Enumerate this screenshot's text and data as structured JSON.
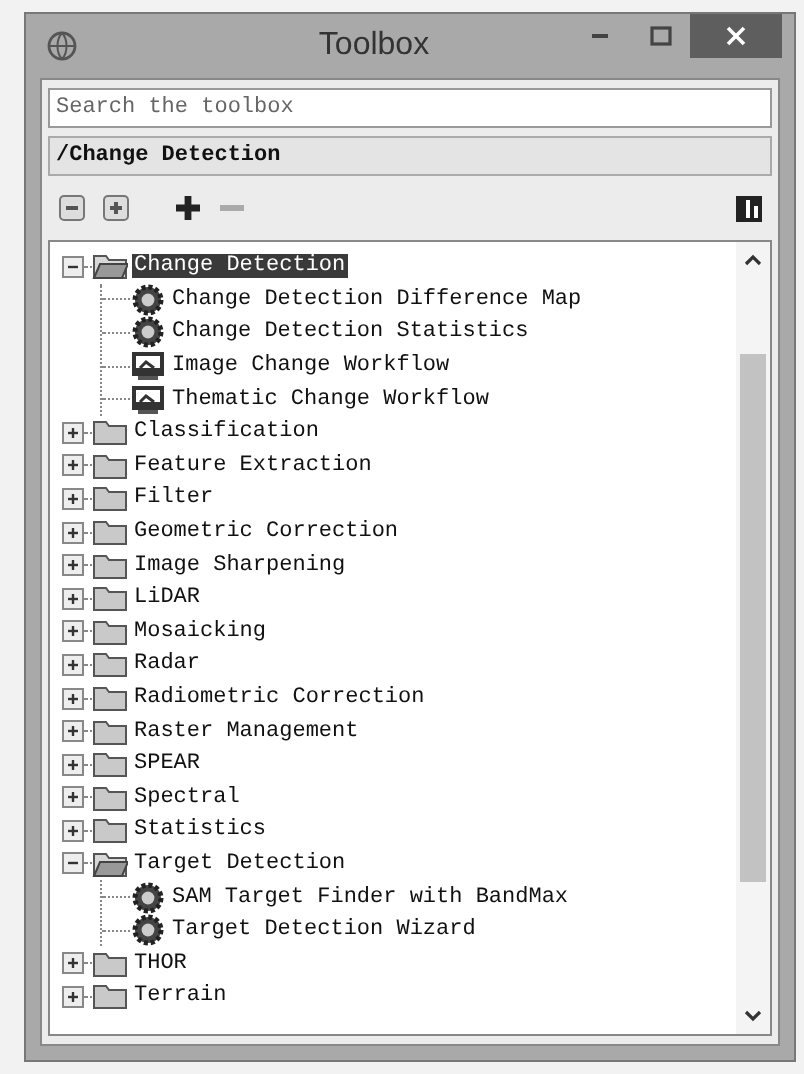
{
  "window": {
    "title": "Toolbox"
  },
  "search": {
    "placeholder": "Search the toolbox"
  },
  "path": "/Change Detection",
  "tree": [
    {
      "label": "Change Detection",
      "kind": "folder",
      "expanded": true,
      "selected": true,
      "children": [
        {
          "label": "Change Detection Difference Map",
          "kind": "tool",
          "selected": false
        },
        {
          "label": "Change Detection Statistics",
          "kind": "tool",
          "selected": false
        },
        {
          "label": "Image Change Workflow",
          "kind": "workflow",
          "selected": false
        },
        {
          "label": "Thematic Change Workflow",
          "kind": "workflow",
          "selected": false
        }
      ]
    },
    {
      "label": "Classification",
      "kind": "folder",
      "expanded": false,
      "selected": false
    },
    {
      "label": "Feature Extraction",
      "kind": "folder",
      "expanded": false,
      "selected": false
    },
    {
      "label": "Filter",
      "kind": "folder",
      "expanded": false,
      "selected": false
    },
    {
      "label": "Geometric Correction",
      "kind": "folder",
      "expanded": false,
      "selected": false
    },
    {
      "label": "Image Sharpening",
      "kind": "folder",
      "expanded": false,
      "selected": false
    },
    {
      "label": "LiDAR",
      "kind": "folder",
      "expanded": false,
      "selected": false
    },
    {
      "label": "Mosaicking",
      "kind": "folder",
      "expanded": false,
      "selected": false
    },
    {
      "label": "Radar",
      "kind": "folder",
      "expanded": false,
      "selected": false
    },
    {
      "label": "Radiometric Correction",
      "kind": "folder",
      "expanded": false,
      "selected": false
    },
    {
      "label": "Raster Management",
      "kind": "folder",
      "expanded": false,
      "selected": false
    },
    {
      "label": "SPEAR",
      "kind": "folder",
      "expanded": false,
      "selected": false
    },
    {
      "label": "Spectral",
      "kind": "folder",
      "expanded": false,
      "selected": false
    },
    {
      "label": "Statistics",
      "kind": "folder",
      "expanded": false,
      "selected": false
    },
    {
      "label": "Target Detection",
      "kind": "folder",
      "expanded": true,
      "selected": false,
      "children": [
        {
          "label": "SAM Target Finder with BandMax",
          "kind": "tool",
          "selected": false
        },
        {
          "label": "Target Detection Wizard",
          "kind": "tool",
          "selected": false
        }
      ]
    },
    {
      "label": "THOR",
      "kind": "folder",
      "expanded": false,
      "selected": false
    },
    {
      "label": "Terrain",
      "kind": "folder",
      "expanded": false,
      "selected": false
    }
  ]
}
